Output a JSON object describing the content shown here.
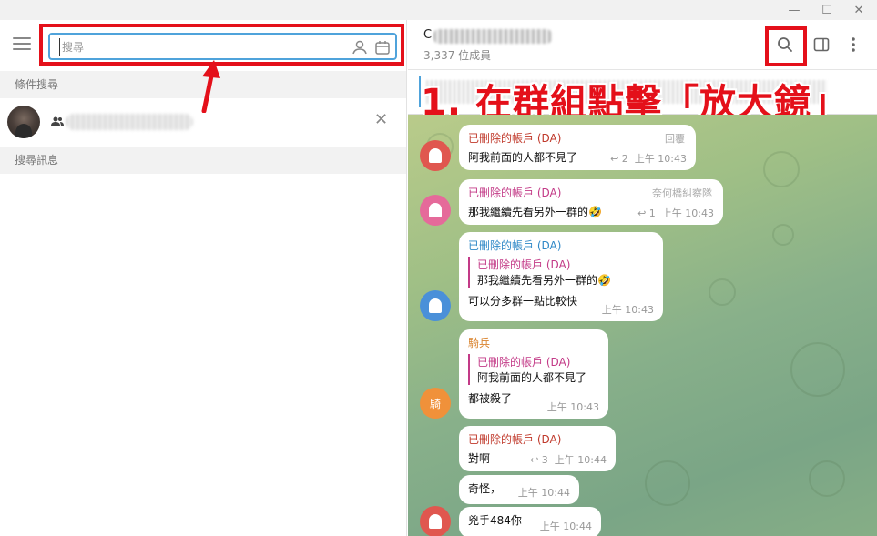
{
  "window": {
    "minimize": "—",
    "maximize": "☐",
    "close": "✕"
  },
  "search": {
    "placeholder": "搜尋",
    "value": ""
  },
  "left_panel": {
    "filter_header": "條件搜尋",
    "messages_header": "搜尋訊息"
  },
  "chat": {
    "title_initial": "C",
    "members": "3,337 位成員"
  },
  "annotation": "1. 在群組點擊「放大鏡」",
  "messages": [
    {
      "sender": "已刪除的帳戶 (DA)",
      "sender_color": "#c0392b",
      "tag": "回覆",
      "text": "阿我前面的人都不見了",
      "replies": "↩ 2",
      "time": "上午 10:43",
      "avatar_color": "#e0574f"
    },
    {
      "sender": "已刪除的帳戶 (DA)",
      "sender_color": "#c33a87",
      "tag": "奈何橋糾察隊",
      "text": "那我繼續先看另外一群的🤣",
      "replies": "↩ 1",
      "time": "上午 10:43",
      "avatar_color": "#e56a9a"
    },
    {
      "sender": "已刪除的帳戶 (DA)",
      "sender_color": "#2f88c7",
      "quote_name": "已刪除的帳戶 (DA)",
      "quote_text": "那我繼續先看另外一群的🤣",
      "text": "可以分多群一點比較快",
      "time": "上午 10:43",
      "avatar_color": "#4a90d9"
    },
    {
      "sender": "騎兵",
      "sender_color": "#d9822b",
      "quote_name": "已刪除的帳戶 (DA)",
      "quote_text": "阿我前面的人都不見了",
      "text": "都被殺了",
      "time": "上午 10:43",
      "avatar_color": "#f0913a",
      "avatar_text": "騎"
    },
    {
      "sender": "已刪除的帳戶 (DA)",
      "sender_color": "#c0392b",
      "text": "對啊",
      "replies": "↩ 3",
      "time": "上午 10:44",
      "avatar_color": "#e0574f"
    },
    {
      "text": "奇怪，",
      "time": "上午 10:44"
    },
    {
      "text": "兇手484你",
      "time": "上午 10:44",
      "avatar_color": "#e0574f"
    }
  ],
  "colors": {
    "accent": "#4fa3db",
    "highlight": "#e4101a"
  }
}
